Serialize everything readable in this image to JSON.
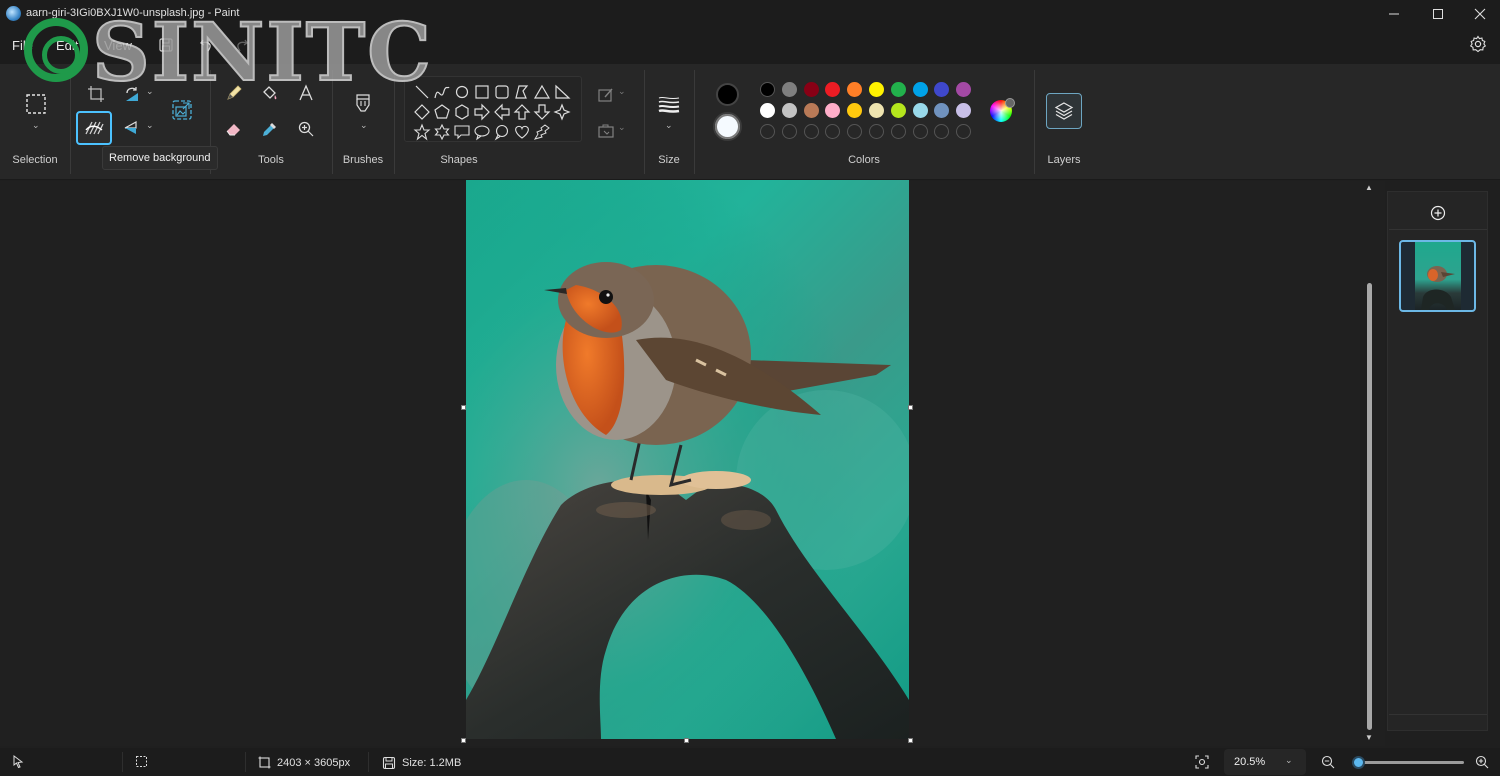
{
  "window": {
    "title": "aarn-giri-3IGi0BXJ1W0-unsplash.jpg - Paint",
    "minimize": "—",
    "maximize": "☐",
    "close": "✕"
  },
  "menu": {
    "file": "File",
    "edit": "Edit",
    "view": "View"
  },
  "watermark": {
    "text": "SINITC"
  },
  "ribbon": {
    "groups": {
      "selection": "Selection",
      "image": "",
      "tools": "Tools",
      "brushes": "Brushes",
      "shapes": "Shapes",
      "size": "Size",
      "colors": "Colors",
      "layers": "Layers"
    },
    "tooltip": "Remove background",
    "chevron": "⌄",
    "colors": {
      "primary": "#000000",
      "secondary": "#f5faff",
      "row1": [
        "#000000",
        "#7f7f7f",
        "#880015",
        "#ed1c24",
        "#ff7f27",
        "#fff200",
        "#22b14c",
        "#00a2e8",
        "#3f48cc",
        "#a349a4"
      ],
      "row2": [
        "#ffffff",
        "#c3c3c3",
        "#b97a57",
        "#ffaec9",
        "#ffc90e",
        "#efe4b0",
        "#b5e61d",
        "#99d9ea",
        "#7092be",
        "#c8bfe7"
      ],
      "custom_slots": 10
    }
  },
  "layers_panel": {
    "add_layer": "Add layer",
    "layer_count": 1
  },
  "canvas": {
    "image_subject": "Robin perched on rusty metal"
  },
  "status": {
    "dimensions": "2403 × 3605px",
    "size": "Size: 1.2MB",
    "zoom": "20.5%",
    "zoom_chevron": "⌄",
    "zoom_slider_fraction": 0.02
  },
  "accent_color": "#4cc2ff"
}
